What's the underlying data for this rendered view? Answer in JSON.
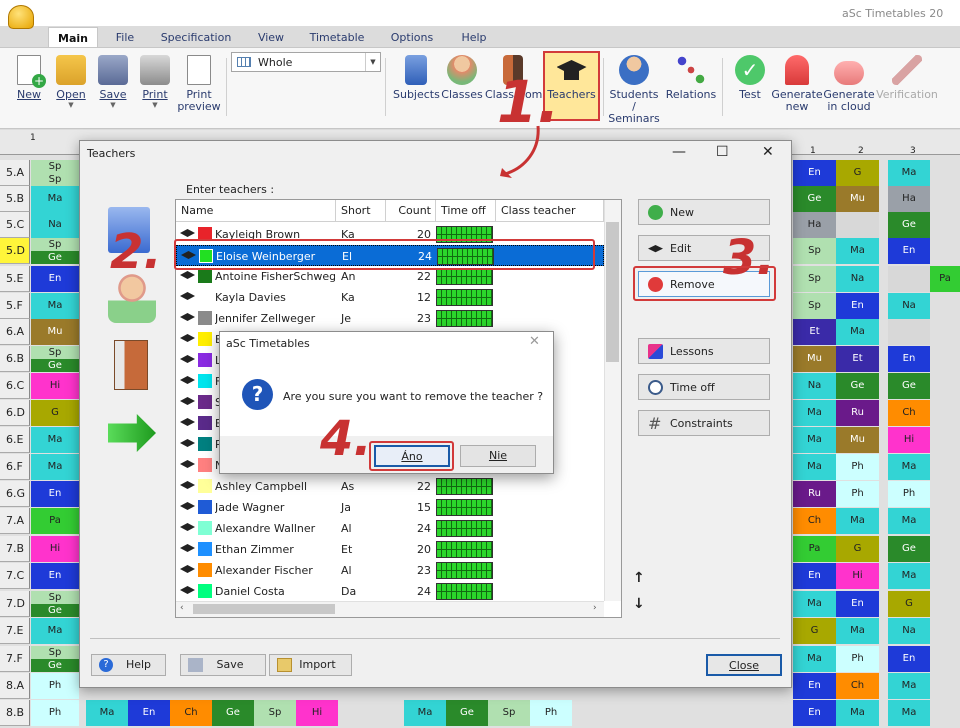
{
  "app": {
    "title": "aSc Timetables 20"
  },
  "menu": {
    "tabs": [
      "Main",
      "File",
      "Specification",
      "View",
      "Timetable",
      "Options",
      "Help"
    ]
  },
  "ribbon": {
    "new": "New",
    "open": "Open",
    "save": "Save",
    "print": "Print",
    "print_preview": "Print\npreview",
    "view_select": "Whole",
    "subjects": "Subjects",
    "classes": "Classes",
    "classrooms": "Classrooms",
    "teachers": "Teachers",
    "students": "Students /\nSeminars",
    "relations": "Relations",
    "test": "Test",
    "generate_new": "Generate\nnew",
    "generate_cloud": "Generate\nin cloud",
    "verification": "Verification"
  },
  "timetable": {
    "col_header_1": "1",
    "right_cols": [
      "1",
      "2",
      "3"
    ],
    "rows": [
      {
        "label": "5.A",
        "left": [
          "Sp",
          "Sp"
        ],
        "r": [
          "En",
          "G",
          "Ma"
        ]
      },
      {
        "label": "5.B",
        "left": [
          "Ma"
        ],
        "r": [
          "Ge",
          "Mu",
          "Ha"
        ]
      },
      {
        "label": "5.C",
        "left": [
          "Na"
        ],
        "r": [
          "Ha",
          "",
          "Ge"
        ]
      },
      {
        "label": "5.D",
        "left": [
          "Sp",
          "Ge"
        ],
        "r": [
          "Sp",
          "Ma",
          "En"
        ]
      },
      {
        "label": "5.E",
        "left": [
          "En"
        ],
        "r": [
          "Sp",
          "Na",
          "",
          "Pa"
        ]
      },
      {
        "label": "5.F",
        "left": [
          "Ma"
        ],
        "r": [
          "Sp",
          "En",
          "Na"
        ]
      },
      {
        "label": "6.A",
        "left": [
          "Mu"
        ],
        "r": [
          "Et",
          "Ma",
          ""
        ]
      },
      {
        "label": "6.B",
        "left": [
          "Sp",
          "Ge"
        ],
        "r": [
          "Mu",
          "Et",
          "En"
        ]
      },
      {
        "label": "6.C",
        "left": [
          "Hi"
        ],
        "r": [
          "Na",
          "Ge",
          "Ge"
        ]
      },
      {
        "label": "6.D",
        "left": [
          "G"
        ],
        "r": [
          "Ma",
          "Ru",
          "Ch"
        ]
      },
      {
        "label": "6.E",
        "left": [
          "Ma"
        ],
        "r": [
          "Ma",
          "Mu",
          "Hi"
        ]
      },
      {
        "label": "6.F",
        "left": [
          "Ma"
        ],
        "r": [
          "Ma",
          "Ph",
          "Ma"
        ]
      },
      {
        "label": "6.G",
        "left": [
          "En"
        ],
        "r": [
          "Ru",
          "Ph",
          "Ph"
        ]
      },
      {
        "label": "7.A",
        "left": [
          "Pa"
        ],
        "r": [
          "Ch",
          "Ma",
          "Ma"
        ]
      },
      {
        "label": "7.B",
        "left": [
          "Hi"
        ],
        "r": [
          "Pa",
          "G",
          "Ge"
        ]
      },
      {
        "label": "7.C",
        "left": [
          "En"
        ],
        "r": [
          "En",
          "Hi",
          "Ma"
        ]
      },
      {
        "label": "7.D",
        "left": [
          "Sp",
          "Ge"
        ],
        "r": [
          "Ma",
          "En",
          "G"
        ]
      },
      {
        "label": "7.E",
        "left": [
          "Ma"
        ],
        "r": [
          "G",
          "Ma",
          "Na"
        ]
      },
      {
        "label": "7.F",
        "left": [
          "Sp",
          "Ge"
        ],
        "r": [
          "Ma",
          "Ph",
          "En"
        ]
      },
      {
        "label": "8.A",
        "left": [
          "Ph"
        ],
        "r": [
          "En",
          "Ch",
          "Ma"
        ]
      },
      {
        "label": "8.B",
        "left": [
          "Ph"
        ],
        "r": [
          "En",
          "Ma",
          "Ma"
        ]
      }
    ],
    "bottom_row": [
      "Ma",
      "En",
      "Ch",
      "Ge",
      "Sp",
      "Hi",
      "Ma",
      "Ge",
      "Sp",
      "Ph"
    ]
  },
  "dialog": {
    "title": "Teachers",
    "enter_label": "Enter teachers :",
    "columns": [
      "Name",
      "Short",
      "Count",
      "Time off",
      "Class teacher"
    ],
    "teachers": [
      {
        "name": "Kayleigh Brown",
        "short": "Ka",
        "count": "20",
        "color": "#e8232a"
      },
      {
        "name": "Eloise Weinberger",
        "short": "El",
        "count": "24",
        "color": "#22e022"
      },
      {
        "name": "Antoine FisherSchwegler",
        "short": "An",
        "count": "22",
        "color": "#1a7a1a"
      },
      {
        "name": "Kayla Davies",
        "short": "Ka",
        "count": "12",
        "color": ""
      },
      {
        "name": "Jennifer Zellweger",
        "short": "Je",
        "count": "23",
        "color": "#8a8a8a"
      },
      {
        "name": "E",
        "short": "",
        "count": "",
        "color": "#ffee00"
      },
      {
        "name": "L",
        "short": "",
        "count": "",
        "color": "#8a2be2"
      },
      {
        "name": "F",
        "short": "",
        "count": "",
        "color": "#00e5ee"
      },
      {
        "name": "S",
        "short": "",
        "count": "",
        "color": "#6b2a8a"
      },
      {
        "name": "E",
        "short": "",
        "count": "",
        "color": "#5a2a8a"
      },
      {
        "name": "P",
        "short": "",
        "count": "",
        "color": "#008080"
      },
      {
        "name": "N",
        "short": "",
        "count": "",
        "color": "#ff8080"
      },
      {
        "name": "Ashley Campbell",
        "short": "As",
        "count": "22",
        "color": "#ffff99"
      },
      {
        "name": "Jade Wagner",
        "short": "Ja",
        "count": "15",
        "color": "#1f5bd6"
      },
      {
        "name": "Alexandre Wallner",
        "short": "Al",
        "count": "24",
        "color": "#7fffd4"
      },
      {
        "name": "Ethan Zimmer",
        "short": "Et",
        "count": "20",
        "color": "#1e90ff"
      },
      {
        "name": "Alexander Fischer",
        "short": "Al",
        "count": "23",
        "color": "#ff8c00"
      },
      {
        "name": "Daniel Costa",
        "short": "Da",
        "count": "24",
        "color": "#00ff7f"
      }
    ],
    "buttons": {
      "new": "New",
      "edit": "Edit",
      "remove": "Remove",
      "lessons": "Lessons",
      "time_off": "Time off",
      "constraints": "Constraints"
    },
    "footer": {
      "help": "Help",
      "save": "Save",
      "import": "Import",
      "close": "Close"
    }
  },
  "confirm": {
    "title": "aSc Timetables",
    "message": "Are you sure you want to remove the teacher ?",
    "yes": "Áno",
    "no": "Nie"
  },
  "annotations": {
    "step1": "1.",
    "step2": "2.",
    "step3": "3.",
    "step4": "4."
  }
}
